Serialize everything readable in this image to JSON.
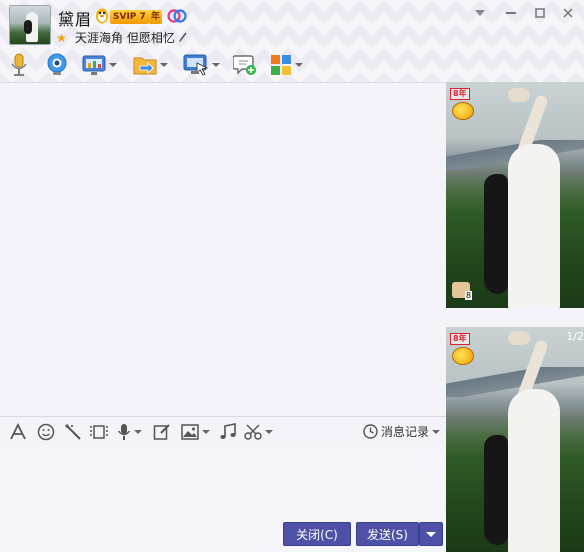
{
  "contact": {
    "name": "黛眉",
    "vip_label": "SVIP 7",
    "year_label": "年",
    "signature": "天涯海角 但愿相忆"
  },
  "toolbar": {
    "icons": [
      "microphone-icon",
      "video-camera-icon",
      "screen-share-icon",
      "file-transfer-icon",
      "remote-assist-icon",
      "new-discussion-icon",
      "apps-icon"
    ]
  },
  "format_bar": {
    "history_label": "消息记录"
  },
  "buttons": {
    "close": "关闭(C)",
    "send": "发送(S)"
  },
  "photos": [
    {
      "vip_badge": "8年",
      "like_badge_count": "8"
    },
    {
      "vip_badge": "8年",
      "page_indicator": "1/2"
    }
  ],
  "colors": {
    "accent": "#4d52a8",
    "vip_gold": "#f19a06",
    "background": "#f4f3f9"
  }
}
